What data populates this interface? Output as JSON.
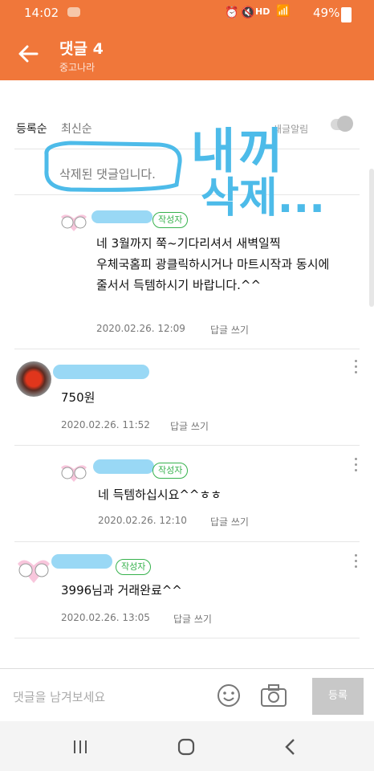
{
  "status_bar": {
    "time": "14:02",
    "battery": "49%",
    "indicators": "HD"
  },
  "app_bar": {
    "title": "댓글 4",
    "subtitle": "중고나라"
  },
  "sort": {
    "registered": "등록순",
    "latest": "최신순",
    "toggle_label": "새글알림"
  },
  "deleted_comment": "삭제된 댓글입니다.",
  "comments": [
    {
      "text_lines": [
        "네 3월까지 쭉~기다리셔서 새벽일찍",
        "우체국홈피 광클릭하시거나 마트시작과 동시에",
        "줄서서 득템하시기 바랍니다.^^"
      ],
      "badge": "작성자",
      "date": "2020.02.26. 12:09",
      "reply": "답글 쓰기"
    },
    {
      "text": "750원",
      "date": "2020.02.26. 11:52",
      "reply": "답글 쓰기"
    },
    {
      "text": "네 득템하십시요^^ㅎㅎ",
      "badge": "작성자",
      "date": "2020.02.26. 12:10",
      "reply": "답글 쓰기"
    },
    {
      "text": "3996님과 거래완료^^",
      "badge": "작성자",
      "date": "2020.02.26. 13:05",
      "reply": "답글 쓰기"
    }
  ],
  "input": {
    "placeholder": "댓글을 남겨보세요",
    "submit": "등록"
  },
  "annotation": {
    "line1": "내꺼",
    "line2": "삭제..."
  },
  "colors": {
    "brand": "#f0773a",
    "badge": "#37b24d",
    "scribble": "#4dbbe9"
  }
}
